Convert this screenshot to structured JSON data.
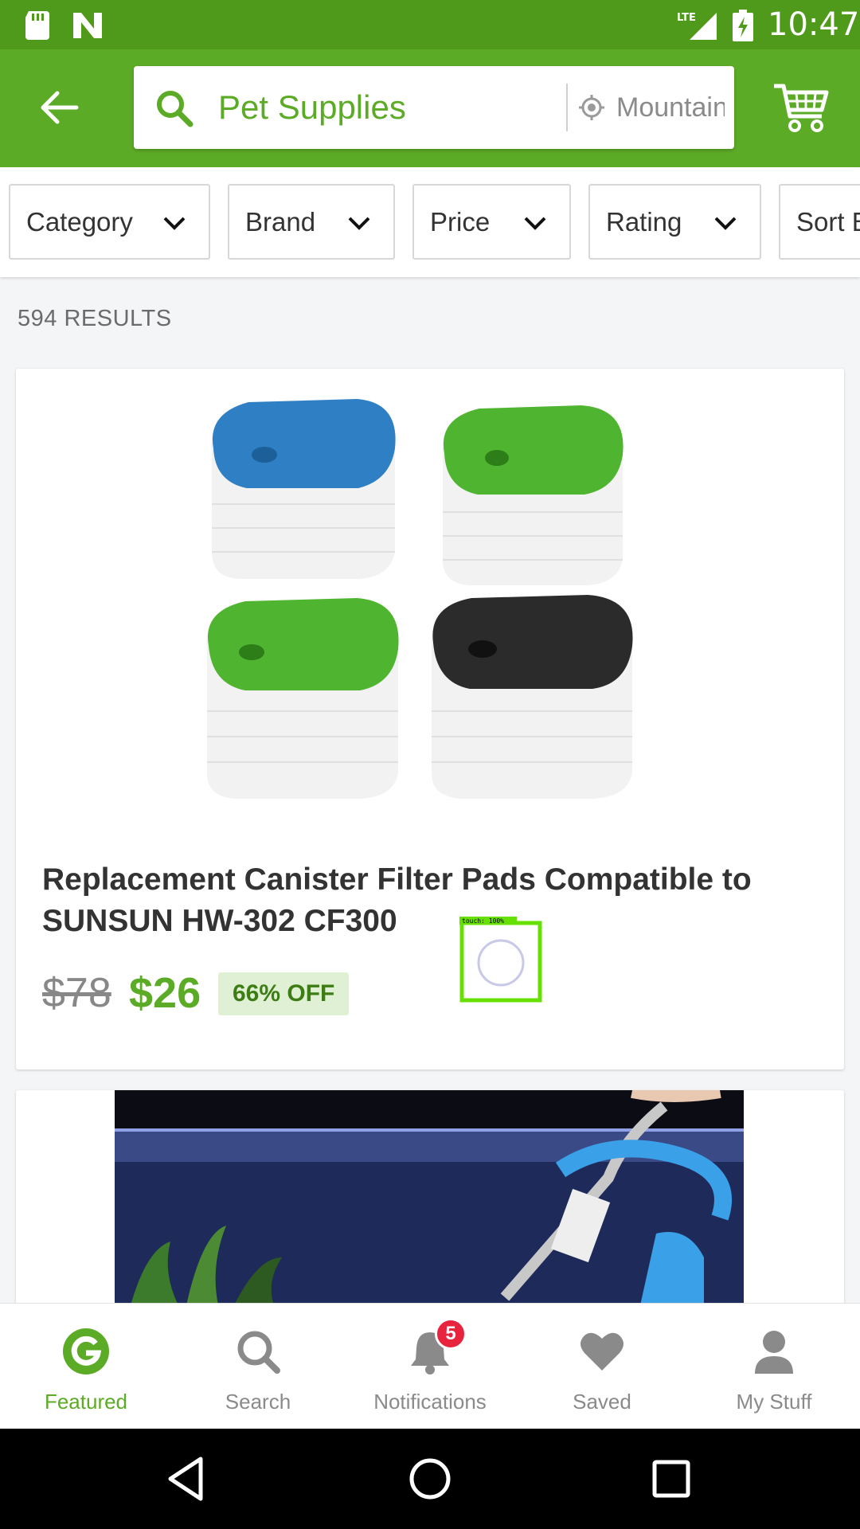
{
  "status_bar": {
    "time": "10:47",
    "network": "LTE"
  },
  "header": {
    "search_query": "Pet Supplies",
    "location": "Mountain View",
    "accent_color": "#5cab26"
  },
  "filters": [
    {
      "label": "Category"
    },
    {
      "label": "Brand"
    },
    {
      "label": "Price"
    },
    {
      "label": "Rating"
    },
    {
      "label": "Sort By"
    }
  ],
  "results": {
    "count_label": "594 RESULTS"
  },
  "products": [
    {
      "title": "Replacement Canister Filter Pads Compatible to SUNSUN HW-302 CF300",
      "original_price": "$78",
      "price": "$26",
      "discount": "66% OFF"
    }
  ],
  "touch_overlay": {
    "label": "touch: 100%"
  },
  "bottom_nav": {
    "items": [
      {
        "label": "Featured",
        "icon": "groupon-g-icon"
      },
      {
        "label": "Search",
        "icon": "search-icon"
      },
      {
        "label": "Notifications",
        "icon": "bell-icon"
      },
      {
        "label": "Saved",
        "icon": "heart-icon"
      },
      {
        "label": "My Stuff",
        "icon": "person-icon"
      }
    ],
    "notification_badge": "5"
  }
}
